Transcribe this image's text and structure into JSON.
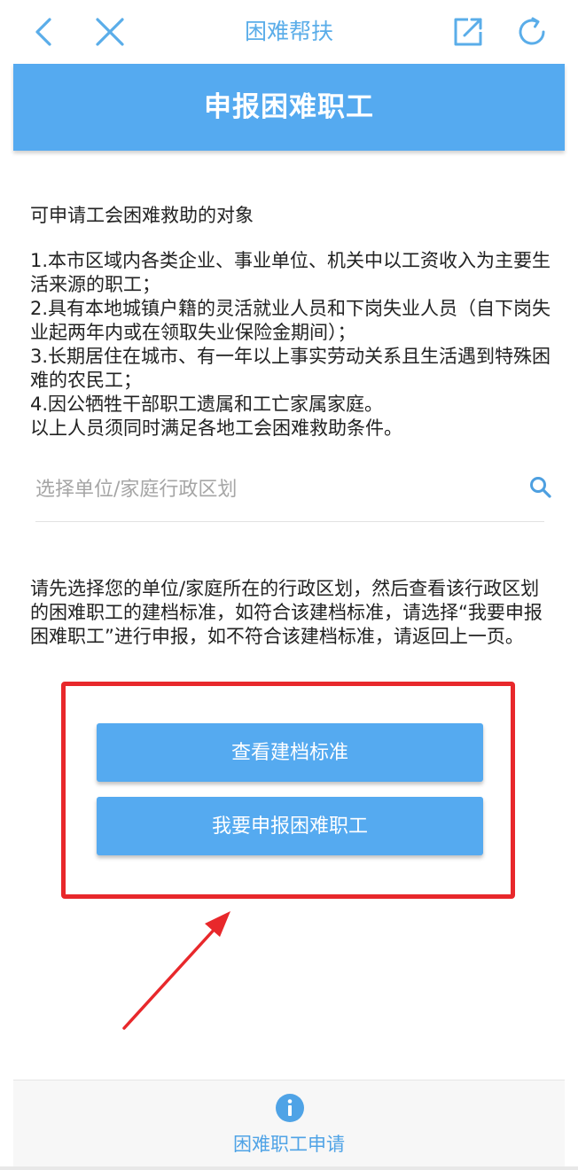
{
  "nav": {
    "title": "困难帮扶",
    "icons": [
      "back-arrow-icon",
      "close-icon",
      "share-icon",
      "refresh-icon"
    ]
  },
  "header": {
    "title": "申报困难职工"
  },
  "intro": {
    "heading": "可申请工会困难救助的对象",
    "criteria": [
      "1.本市区域内各类企业、事业单位、机关中以工资收入为主要生活来源的职工；",
      "2.具有本地城镇户籍的灵活就业人员和下岗失业人员（自下岗失业起两年内或在领取失业保险金期间）；",
      "3.长期居住在城市、有一年以上事实劳动关系且生活遇到特殊困难的农民工；",
      "4.因公牺牲干部职工遗属和工亡家属家庭。",
      "以上人员须同时满足各地工会困难救助条件。"
    ]
  },
  "search": {
    "placeholder": "选择单位/家庭行政区划",
    "value": ""
  },
  "instructions": {
    "text": "请先选择您的单位/家庭所在的行政区划，然后查看该行政区划的困难职工的建档标准，如符合该建档标准，请选择“我要申报困难职工”进行申报，如不符合该建档标准，请返回上一页。"
  },
  "buttons": {
    "view_standard": "查看建档标准",
    "apply": "我要申报困难职工"
  },
  "bottom_nav": {
    "tab_label": "困难职工申请",
    "tab_icon": "info-icon"
  },
  "colors": {
    "accent": "#55aaf0",
    "highlight": "#e8282b",
    "nav_text": "#5aade9"
  }
}
